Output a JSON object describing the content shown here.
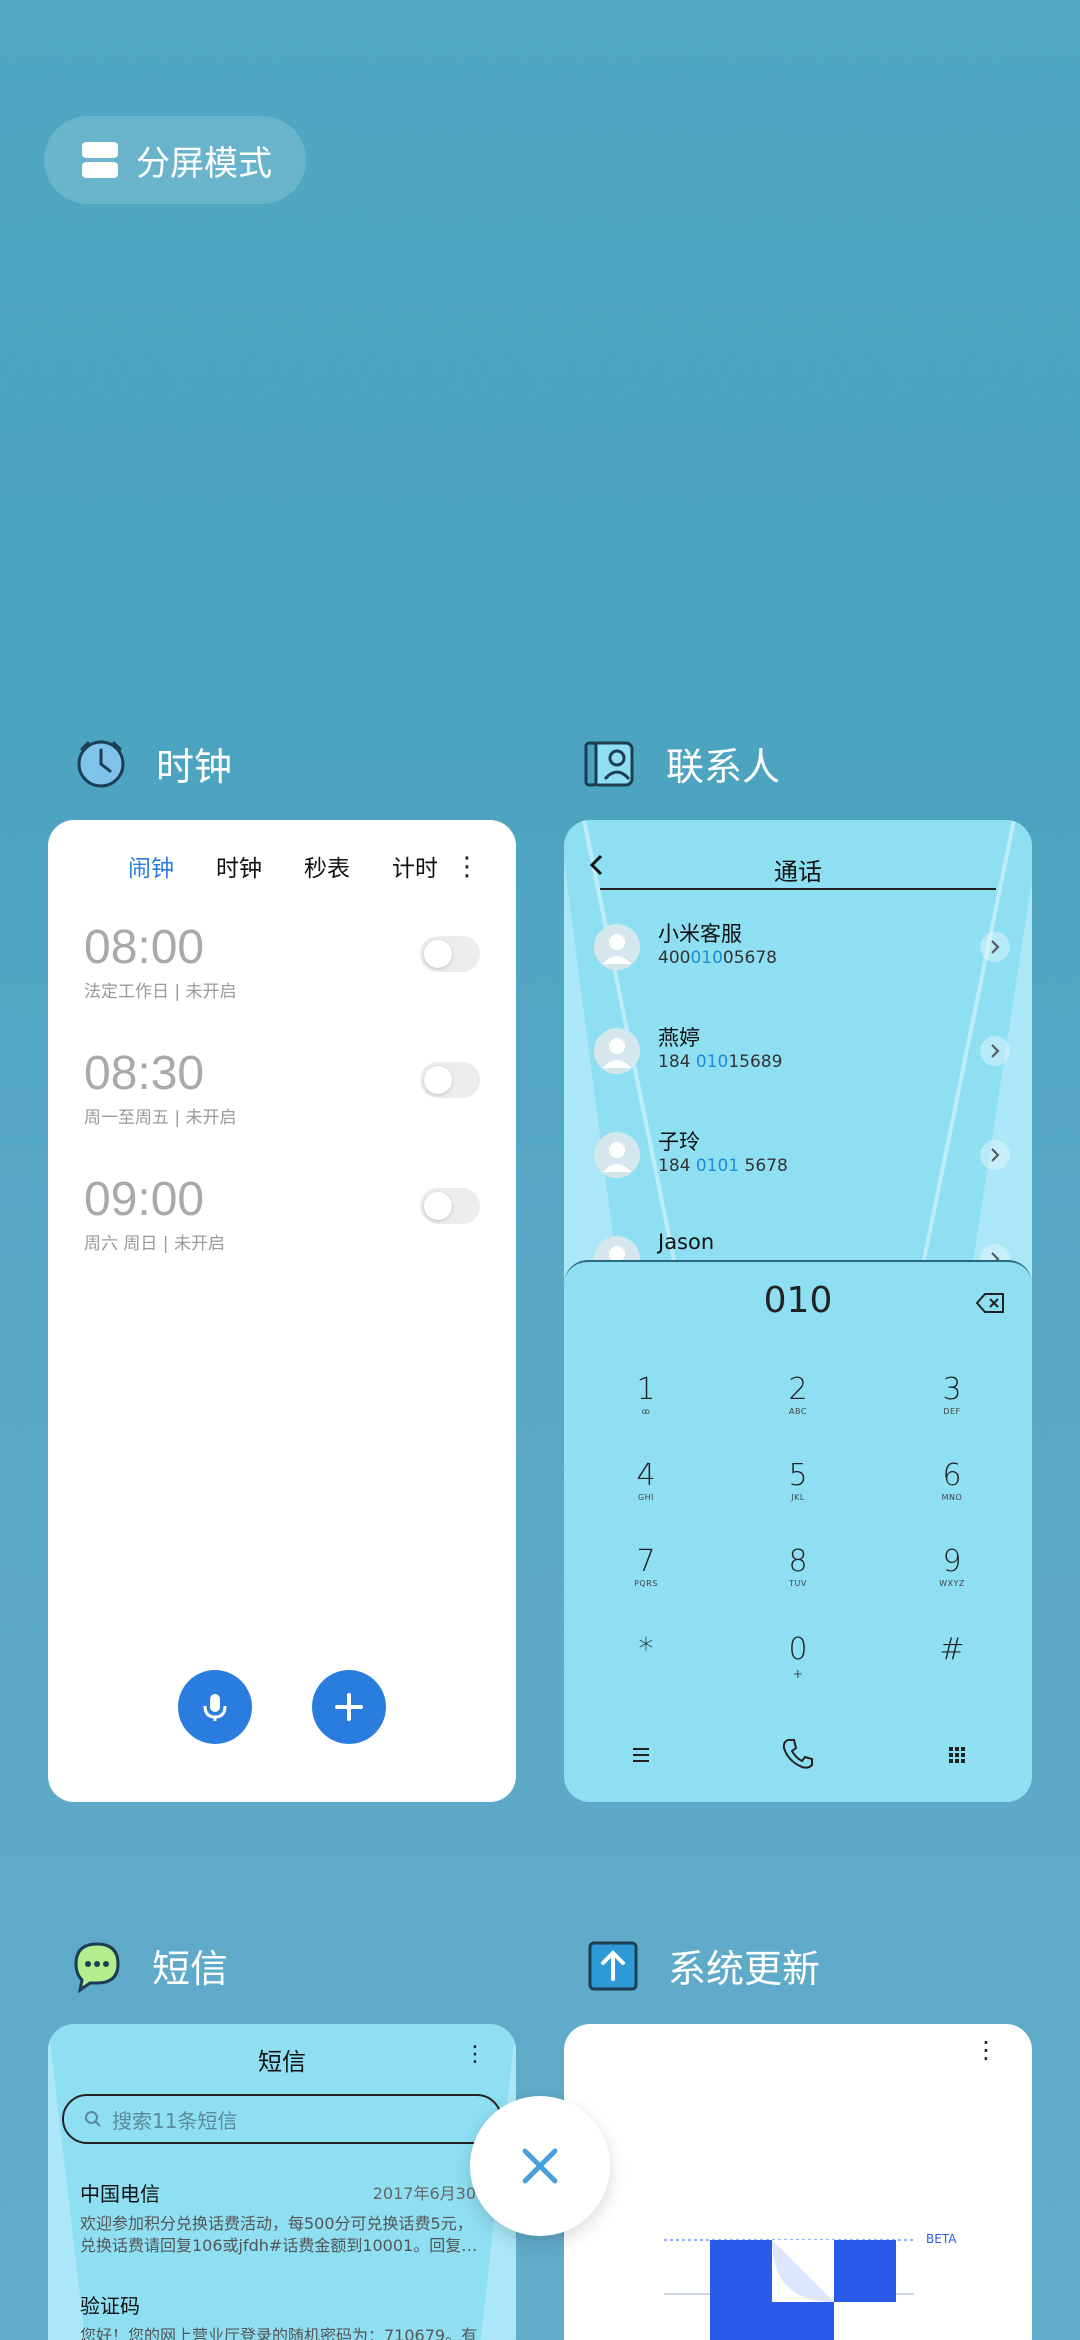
{
  "split": {
    "label": "分屏模式"
  },
  "clock": {
    "app_name": "时钟",
    "tabs": [
      {
        "label": "闹钟"
      },
      {
        "label": "时钟"
      },
      {
        "label": "秒表"
      },
      {
        "label": "计时"
      }
    ],
    "more": "⋮",
    "alarms": [
      {
        "time": "08:00",
        "sub": "法定工作日 | 未开启"
      },
      {
        "time": "08:30",
        "sub": "周一至周五 | 未开启"
      },
      {
        "time": "09:00",
        "sub": "周六 周日 | 未开启"
      }
    ]
  },
  "contacts": {
    "app_name": "联系人",
    "title": "通话",
    "list": [
      {
        "name": "小米客服",
        "num_a": "400",
        "num_hl": "010",
        "num_b": "05678"
      },
      {
        "name": "燕婷",
        "num_a": "184 ",
        "num_hl": "010",
        "num_b": "15689"
      },
      {
        "name": "子玲",
        "num_a": "184 ",
        "num_hl": "0101",
        "num_b": " 5678"
      },
      {
        "name": "Jason",
        "num_a": "",
        "num_hl": "",
        "num_b": ""
      }
    ],
    "dial_display": "010",
    "keys": [
      {
        "d": "1",
        "l": "ꝏ"
      },
      {
        "d": "2",
        "l": "ABC"
      },
      {
        "d": "3",
        "l": "DEF"
      },
      {
        "d": "4",
        "l": "GHI"
      },
      {
        "d": "5",
        "l": "JKL"
      },
      {
        "d": "6",
        "l": "MNO"
      },
      {
        "d": "7",
        "l": "PQRS"
      },
      {
        "d": "8",
        "l": "TUV"
      },
      {
        "d": "9",
        "l": "WXYZ"
      },
      {
        "d": "*",
        "l": ""
      },
      {
        "d": "0",
        "l": "+"
      },
      {
        "d": "#",
        "l": ""
      }
    ]
  },
  "sms": {
    "app_name": "短信",
    "title": "短信",
    "more": "⋮",
    "search_placeholder": "搜索11条短信",
    "items": [
      {
        "from": "中国电信",
        "date": "2017年6月30日",
        "body1": "欢迎参加积分兑换话费活动，每500分可兑换话费5元，",
        "body2": "兑换话费请回复106或jfdh#话费金额到10001。回复…"
      },
      {
        "from": "验证码",
        "date": "",
        "body1": "您好！您的网上营业厅登录的随机密码为：710679。有",
        "body2": ""
      }
    ]
  },
  "update": {
    "app_name": "系统更新",
    "more": "⋮",
    "beta": "BETA"
  }
}
